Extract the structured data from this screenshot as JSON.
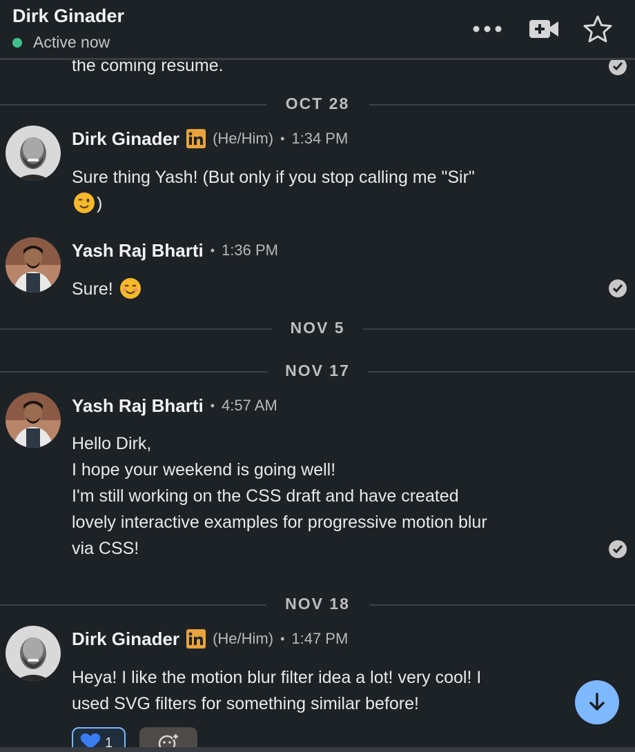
{
  "header": {
    "contact_name": "Dirk Ginader",
    "status": "Active now",
    "status_color": "#3fc28a",
    "icons": [
      "more-options-icon",
      "video-call-icon",
      "star-icon"
    ]
  },
  "messages": {
    "previous_tail": "the coming resume.",
    "dividers": {
      "d1": "OCT 28",
      "d2": "NOV 5",
      "d3": "NOV 17",
      "d4": "NOV 18"
    },
    "m1": {
      "sender": "Dirk Ginader",
      "pronouns": "(He/Him)",
      "time": "1:34 PM",
      "line1": "Sure thing Yash! (But only if you stop calling me \"Sir\"",
      "line2_end": ")"
    },
    "m2": {
      "sender": "Yash Raj Bharti",
      "time": "1:36 PM",
      "text": "Sure!"
    },
    "m3": {
      "sender": "Yash Raj Bharti",
      "time": "4:57 AM",
      "lines": [
        "Hello Dirk,",
        "I hope your weekend is going well!",
        "I'm still working on the CSS draft and have created",
        "lovely interactive examples for progressive motion blur",
        "via CSS!"
      ]
    },
    "m4": {
      "sender": "Dirk Ginader",
      "pronouns": "(He/Him)",
      "time": "1:47 PM",
      "lines": [
        "Heya! I like the motion blur filter idea a lot! very cool! I",
        "used SVG filters for something similar before!"
      ],
      "reaction_count": "1"
    },
    "separator": "•"
  },
  "colors": {
    "background": "#1d2226",
    "linkedin_badge": "#e8a33d",
    "accent_blue": "#7eb8ff"
  }
}
